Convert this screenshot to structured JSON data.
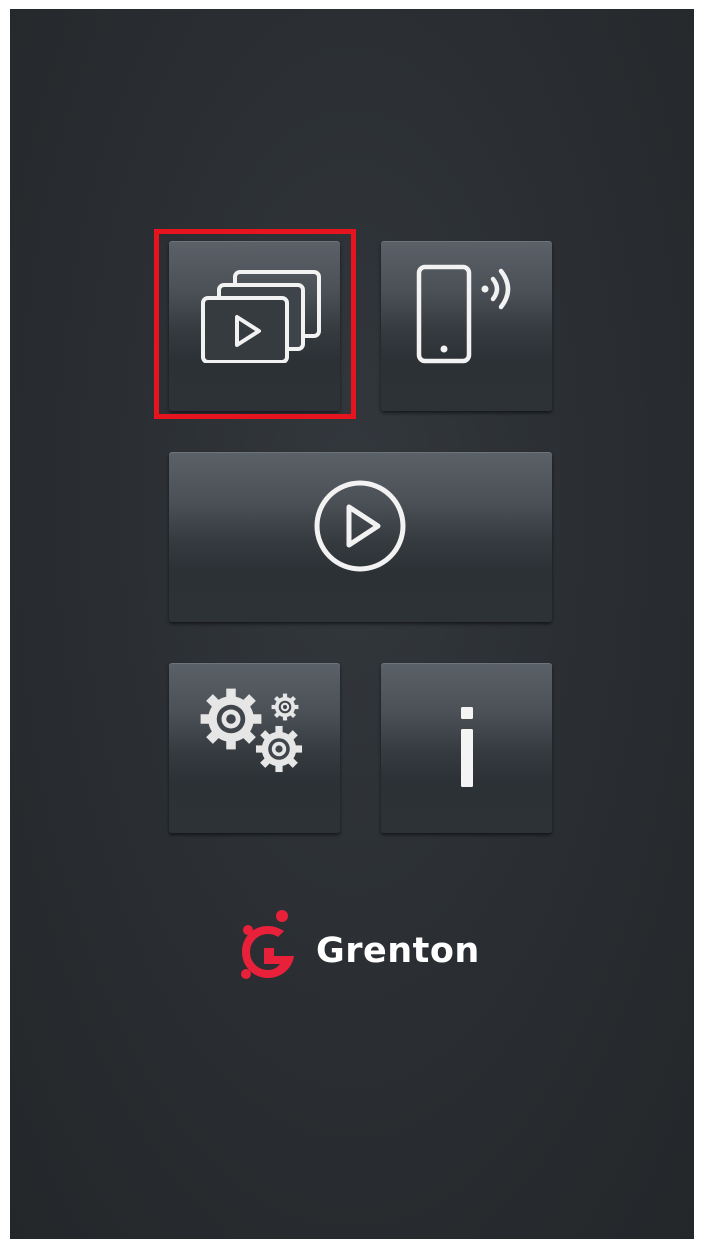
{
  "menu": {
    "tiles": [
      {
        "id": "slideshow",
        "icon": "slideshow-icon",
        "selected": true
      },
      {
        "id": "remote",
        "icon": "phone-remote-icon",
        "selected": false
      },
      {
        "id": "play",
        "icon": "play-circle-icon",
        "selected": false
      },
      {
        "id": "settings",
        "icon": "gears-icon",
        "selected": false
      },
      {
        "id": "info",
        "icon": "info-icon",
        "selected": false
      }
    ]
  },
  "brand": {
    "name": "Grenton",
    "logo_color": "#e8203a"
  },
  "highlight_color": "#e5141e"
}
